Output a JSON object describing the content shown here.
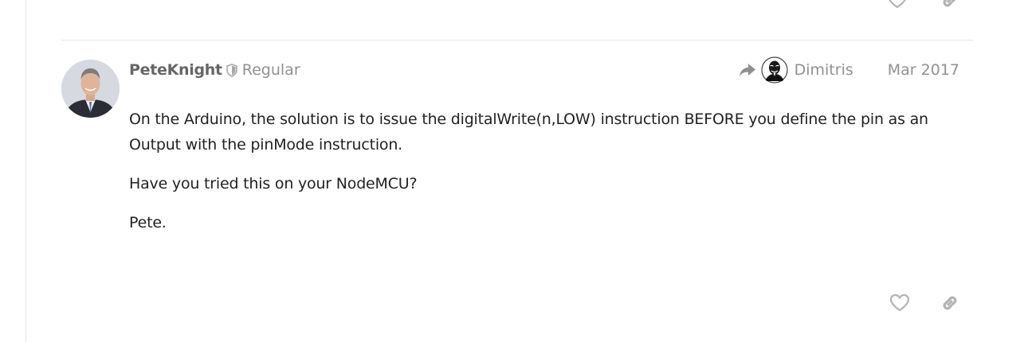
{
  "post": {
    "username": "PeteKnight",
    "user_title": "Regular",
    "reply_to_name": "Dimitris",
    "date": "Mar 2017",
    "paragraphs": [
      "On the Arduino, the solution is to issue the digitalWrite(n,LOW) instruction BEFORE you define the pin as an Output with the pinMode instruction.",
      "Have you tried this on your NodeMCU?",
      "Pete."
    ]
  },
  "icons": {
    "moderator_badge": "shield-icon",
    "reply_indicator": "share-arrow-icon",
    "like": "heart-icon",
    "share_link": "link-icon"
  },
  "colors": {
    "username": "#666666",
    "meta_text": "#919191",
    "body_text": "#222222",
    "icon": "#b3b3b3",
    "divider": "#e6e6e6"
  }
}
